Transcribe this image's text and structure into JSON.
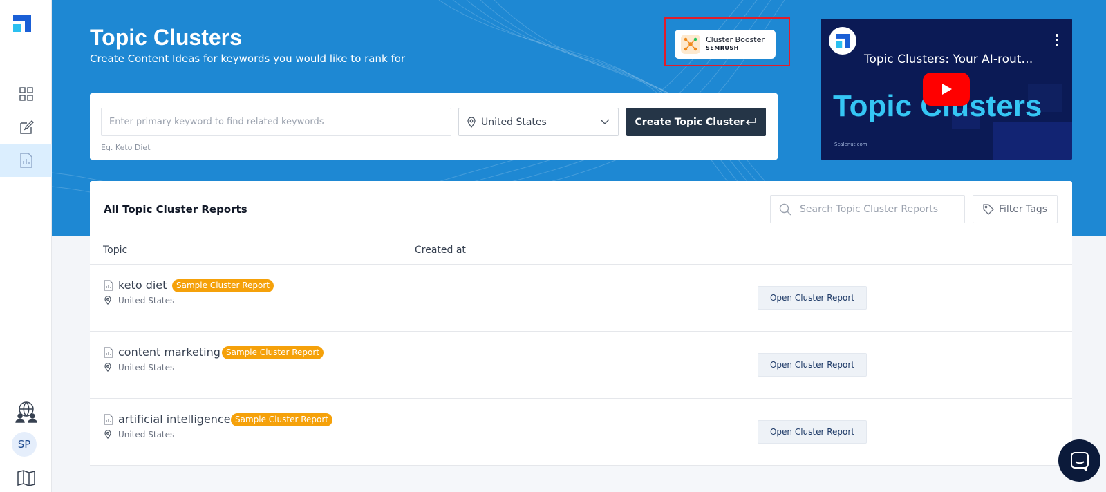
{
  "header": {
    "title": "Topic Clusters",
    "subtitle": "Create Content Ideas for keywords you would like to rank for"
  },
  "booster": {
    "name": "Cluster Booster",
    "brand": "SEMRUSH"
  },
  "video": {
    "title": "Topic Clusters: Your AI-rout…",
    "big_text": "Topic Clusters",
    "site": "Scalenut.com"
  },
  "search": {
    "placeholder": "Enter primary keyword to find related keywords",
    "hint": "Eg. Keto Diet",
    "location": "United States",
    "create_label": "Create Topic Cluster"
  },
  "reports": {
    "title": "All Topic Cluster Reports",
    "search_placeholder": "Search Topic Cluster Reports",
    "filter_label": "Filter Tags",
    "columns": {
      "topic": "Topic",
      "created": "Created at"
    },
    "rows": [
      {
        "topic": "keto diet",
        "badge": "Sample Cluster Report",
        "country": "United States",
        "button": "Open Cluster Report"
      },
      {
        "topic": "content marketing",
        "badge": "Sample Cluster Report",
        "country": "United States",
        "button": "Open Cluster Report"
      },
      {
        "topic": "artificial intelligence",
        "badge": "Sample Cluster Report",
        "country": "United States",
        "button": "Open Cluster Report"
      }
    ]
  },
  "user": {
    "initials": "SP"
  },
  "colors": {
    "hero": "#1e88d3",
    "primary_button": "#253547",
    "badge": "#f5a10a",
    "highlight_frame": "#e11d2b"
  }
}
